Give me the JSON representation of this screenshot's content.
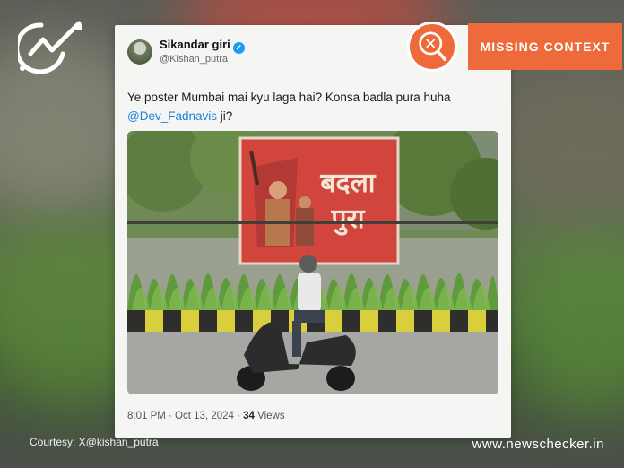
{
  "tweet": {
    "display_name": "Sikandar giri",
    "handle": "@Kishan_putra",
    "text_line1": "Ye poster Mumbai mai kyu laga hai? Konsa badla pura huha",
    "mention": "@Dev_Fadnavis",
    "text_suffix": " ji?",
    "time": "8:01 PM · Oct 13, 2024 · ",
    "views_count": "34",
    "views_label": " Views",
    "poster_text_line1": "बदला",
    "poster_text_line2": "पुरा"
  },
  "badge": {
    "label": "MISSING CONTEXT",
    "color": "#ef6a3a"
  },
  "footer": {
    "courtesy": "Courtesy: X@kishan_putra",
    "site": "www.newschecker.in"
  }
}
